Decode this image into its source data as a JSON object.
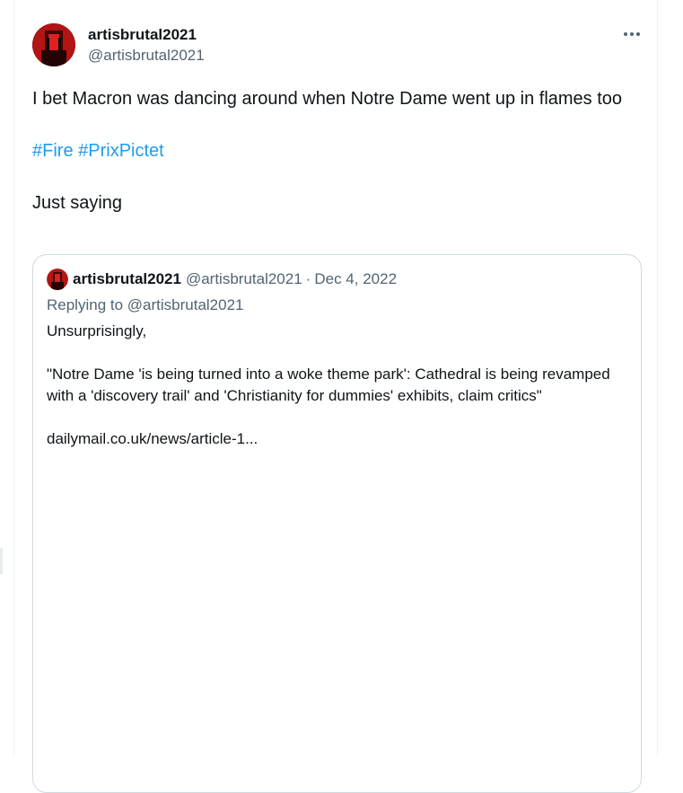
{
  "tweet": {
    "author_name": "artisbrutal2021",
    "author_handle": "@artisbrutal2021",
    "text_line1": "I bet Macron was dancing around when Notre Dame went up in flames too",
    "hashtags": [
      "#Fire",
      "#PrixPictet"
    ],
    "text_line3": "Just saying",
    "more_icon": "ellipsis-icon"
  },
  "quoted": {
    "author_name": "artisbrutal2021",
    "author_handle": "@artisbrutal2021",
    "separator": "·",
    "date": "Dec 4, 2022",
    "replying_to": "Replying to @artisbrutal2021",
    "para1": "Unsurprisingly,",
    "para2": "\"Notre Dame 'is being turned into a woke theme park': Cathedral is being revamped with a 'discovery trail' and 'Christianity for dummies' exhibits, claim critics\"",
    "para3": "dailymail.co.uk/news/article-1..."
  },
  "colors": {
    "link": "#1d9bf0",
    "secondary_text": "#536471",
    "primary_text": "#0f1419",
    "border": "#cfd9de"
  }
}
